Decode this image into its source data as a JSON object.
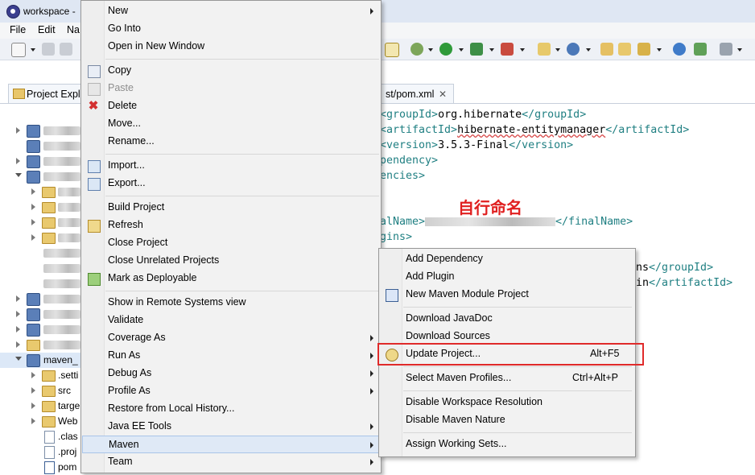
{
  "window": {
    "title": "workspace -"
  },
  "menubar": {
    "items": [
      "File",
      "Edit",
      "Na"
    ]
  },
  "explorer": {
    "tab_label": "Project Expl",
    "rows": [
      {
        "label": ""
      },
      {
        "label": ""
      },
      {
        "label": ""
      },
      {
        "label": ""
      },
      {
        "label": ""
      },
      {
        "label": ""
      },
      {
        "label": ""
      },
      {
        "label": ""
      },
      {
        "label": ""
      },
      {
        "label": ""
      },
      {
        "label": ""
      },
      {
        "label": ""
      },
      {
        "label": ""
      },
      {
        "label": ""
      },
      {
        "label": ""
      },
      {
        "label": "maven_"
      },
      {
        "label": ".setti"
      },
      {
        "label": "src"
      },
      {
        "label": "targe"
      },
      {
        "label": "Web"
      },
      {
        "label": ".clas"
      },
      {
        "label": ".proj"
      },
      {
        "label": "pom"
      }
    ]
  },
  "editor": {
    "tab_label": "st/pom.xml",
    "tab_close": "✕",
    "annotation": "自行命名",
    "lines": [
      {
        "open": "<groupId>",
        "text": "org.hibernate",
        "close": "</groupId>"
      },
      {
        "open": "<artifactId>",
        "text": "hibernate-entitymanager",
        "close": "</artifactId>"
      },
      {
        "open": "<version>",
        "text": "3.5.3-Final",
        "close": "</version>"
      },
      {
        "open": "pendency>",
        "text": "",
        "close": ""
      },
      {
        "open": "encies>",
        "text": "",
        "close": ""
      },
      {
        "open": "alName>",
        "text": "",
        "close": "</finalName>"
      },
      {
        "open": "gins>",
        "text": "",
        "close": ""
      },
      {
        "open": "",
        "text": "ns",
        "close": "</groupId>"
      },
      {
        "open": "",
        "text": "in",
        "close": "</artifactId>"
      }
    ]
  },
  "context_menu": {
    "items": [
      {
        "label": "New",
        "submenu": true
      },
      {
        "label": "Go Into"
      },
      {
        "label": "Open in New Window"
      },
      {
        "label": "Copy"
      },
      {
        "label": "Paste",
        "disabled": true
      },
      {
        "label": "Delete"
      },
      {
        "label": "Move..."
      },
      {
        "label": "Rename..."
      },
      {
        "label": "Import..."
      },
      {
        "label": "Export..."
      },
      {
        "label": "Build Project"
      },
      {
        "label": "Refresh"
      },
      {
        "label": "Close Project"
      },
      {
        "label": "Close Unrelated Projects"
      },
      {
        "label": "Mark as Deployable"
      },
      {
        "label": "Show in Remote Systems view"
      },
      {
        "label": "Validate"
      },
      {
        "label": "Coverage As",
        "submenu": true
      },
      {
        "label": "Run As",
        "submenu": true
      },
      {
        "label": "Debug As",
        "submenu": true
      },
      {
        "label": "Profile As",
        "submenu": true
      },
      {
        "label": "Restore from Local History..."
      },
      {
        "label": "Java EE Tools",
        "submenu": true
      },
      {
        "label": "Maven",
        "submenu": true,
        "selected": true
      },
      {
        "label": "Team",
        "submenu": true
      }
    ]
  },
  "maven_submenu": {
    "items": [
      {
        "label": "Add Dependency"
      },
      {
        "label": "Add Plugin"
      },
      {
        "label": "New Maven Module Project"
      },
      {
        "label": "Download JavaDoc"
      },
      {
        "label": "Download Sources"
      },
      {
        "label": "Update Project...",
        "shortcut": "Alt+F5",
        "highlighted": true
      },
      {
        "label": "Select Maven Profiles...",
        "shortcut": "Ctrl+Alt+P"
      },
      {
        "label": "Disable Workspace Resolution"
      },
      {
        "label": "Disable Maven Nature"
      },
      {
        "label": "Assign Working Sets..."
      }
    ]
  },
  "colors": {
    "highlight_box": "#e02a2a",
    "annotation": "#e02020",
    "xml_tag": "#1f7f82"
  }
}
